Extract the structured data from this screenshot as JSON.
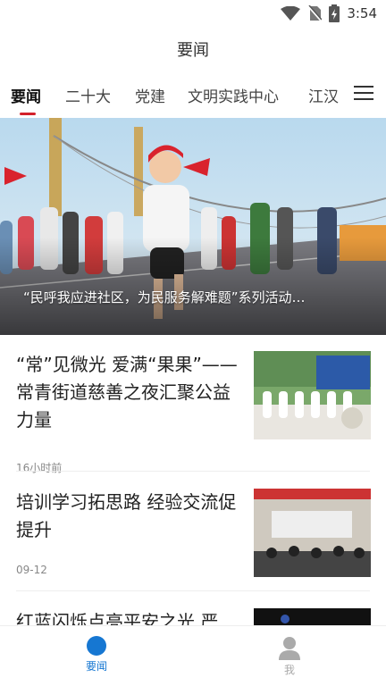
{
  "status_bar": {
    "time": "3:54",
    "icons": [
      "wifi-icon",
      "no-sim-icon",
      "battery-charging-icon"
    ]
  },
  "header": {
    "title": "要闻"
  },
  "tabs": [
    {
      "label": "要闻",
      "active": true
    },
    {
      "label": "二十大",
      "active": false
    },
    {
      "label": "党建",
      "active": false
    },
    {
      "label": "文明实践中心",
      "active": false
    },
    {
      "label": "江汉",
      "active": false
    }
  ],
  "hero": {
    "caption": "“民呼我应进社区，为民服务解难题”系列活动…"
  },
  "news": [
    {
      "title": "“常”见微光 爱满“果果”——常青街道慈善之夜汇聚公益力量",
      "time": "16小时前"
    },
    {
      "title": "培训学习拓思路 经验交流促提升",
      "time": "09-12"
    },
    {
      "title": "红蓝闪烁点亮平安之光 严",
      "time": ""
    }
  ],
  "bottom_nav": [
    {
      "label": "要闻",
      "active": true
    },
    {
      "label": "我",
      "active": false
    }
  ],
  "colors": {
    "accent": "#d3212b",
    "nav_active": "#1677d2",
    "nav_inactive": "#aaaaaa"
  }
}
